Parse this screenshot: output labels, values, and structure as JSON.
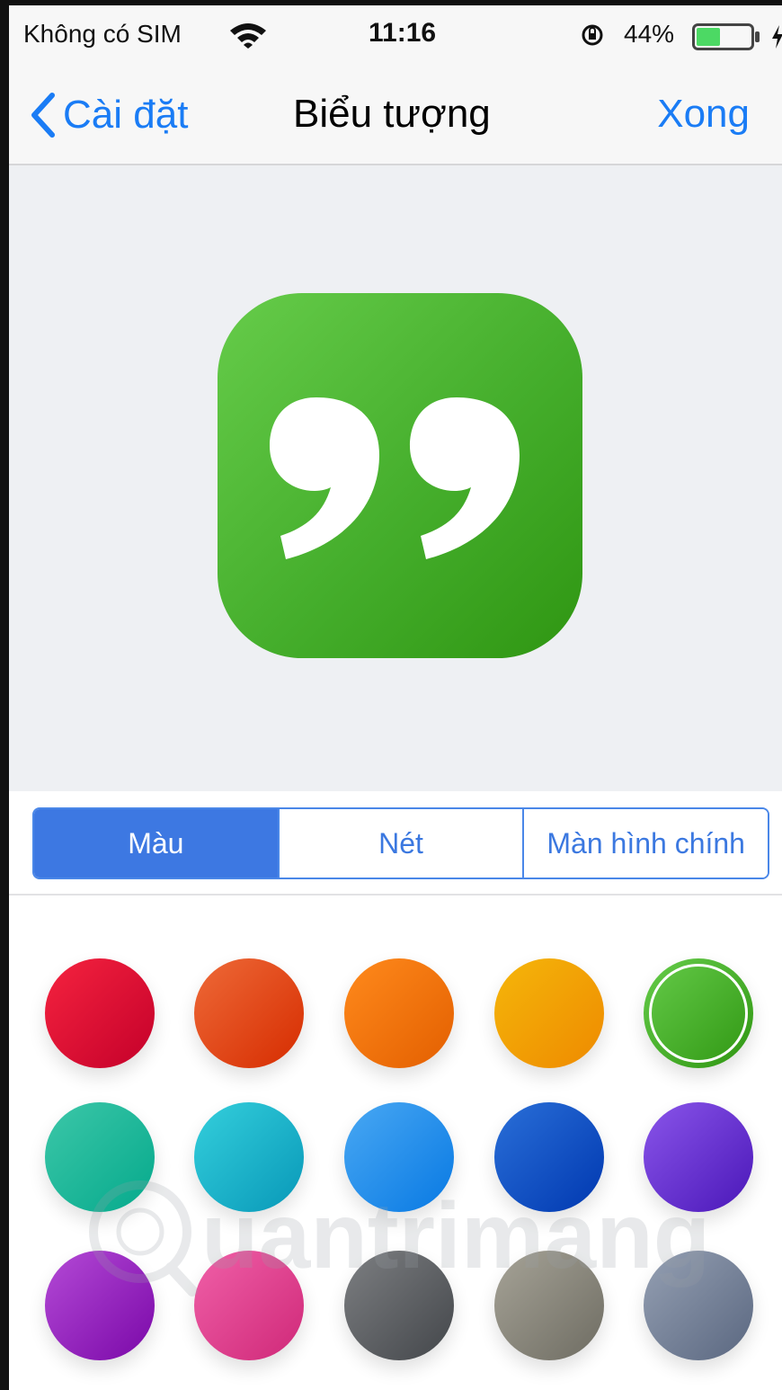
{
  "status_bar": {
    "carrier": "Không có SIM",
    "time": "11:16",
    "battery_percent": "44%",
    "battery_level": 0.44,
    "icons": [
      "wifi-icon",
      "rotation-lock-icon",
      "battery-icon",
      "charging-icon"
    ]
  },
  "nav": {
    "back_label": "Cài đặt",
    "title": "Biểu tượng",
    "done_label": "Xong",
    "accent_color": "#1a7cf5"
  },
  "preview": {
    "icon_name": "quote-icon",
    "icon_color": "#45ae2c"
  },
  "segments": {
    "items": [
      "Màu",
      "Nét",
      "Màn hình chính"
    ],
    "selected_index": 0
  },
  "colors": {
    "swatches": [
      {
        "name": "red",
        "from": "#f5233f",
        "to": "#c4002a",
        "selected": false
      },
      {
        "name": "red-orange",
        "from": "#ee6a38",
        "to": "#d62c00",
        "selected": false
      },
      {
        "name": "orange",
        "from": "#ff8a1c",
        "to": "#e35f00",
        "selected": false
      },
      {
        "name": "yellow",
        "from": "#f5b60a",
        "to": "#ee8a00",
        "selected": false
      },
      {
        "name": "green",
        "from": "#66cc4a",
        "to": "#2f9612",
        "selected": true
      },
      {
        "name": "teal",
        "from": "#3cc7a8",
        "to": "#05a98c",
        "selected": false
      },
      {
        "name": "cyan",
        "from": "#34cfdc",
        "to": "#0898b8",
        "selected": false
      },
      {
        "name": "blue",
        "from": "#49a8f3",
        "to": "#0879e3",
        "selected": false
      },
      {
        "name": "dark-blue",
        "from": "#2a6fd8",
        "to": "#0038b0",
        "selected": false
      },
      {
        "name": "violet",
        "from": "#8a55ea",
        "to": "#4a17b8",
        "selected": false
      },
      {
        "name": "purple",
        "from": "#b44ad6",
        "to": "#7a08a8",
        "selected": false
      },
      {
        "name": "pink",
        "from": "#f060a8",
        "to": "#cf2878",
        "selected": false
      },
      {
        "name": "dark-gray",
        "from": "#7d7f82",
        "to": "#43464a",
        "selected": false
      },
      {
        "name": "taupe",
        "from": "#a6a397",
        "to": "#6e6c62",
        "selected": false
      },
      {
        "name": "slate",
        "from": "#95a0b3",
        "to": "#5a6780",
        "selected": false
      }
    ]
  },
  "watermark": {
    "text": "Quantrimang"
  }
}
